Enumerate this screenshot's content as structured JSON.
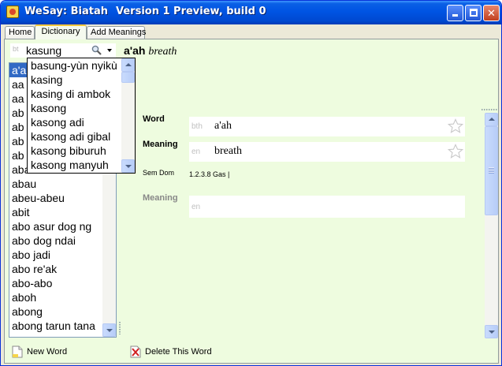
{
  "window": {
    "title": "WeSay: Biatah",
    "version": "Version 1 Preview, build 0"
  },
  "titlebar_buttons": {
    "minimize": "minimize-button",
    "maximize": "maximize-button",
    "close": "close-button"
  },
  "tabs": [
    {
      "label": "Home",
      "active": false
    },
    {
      "label": "Dictionary",
      "active": true
    },
    {
      "label": "Add Meanings",
      "active": false
    }
  ],
  "search": {
    "ws": "bt",
    "value": "kasung",
    "icon": "magnifier-icon"
  },
  "entry_header": {
    "headword": "a'ah",
    "gloss": "breath"
  },
  "word_list": {
    "items": [
      "a'ah",
      "aa",
      "aa",
      "ab",
      "ab",
      "ab",
      "ab",
      "abau tabi",
      "abau",
      "abeu-abeu",
      "abit",
      "abo asur dog ng",
      "abo dog ndai",
      "abo jadi",
      "abo re'ak",
      "abo-abo",
      "aboh",
      "abong",
      "abong tarun tana"
    ],
    "selected_index": 0
  },
  "dropdown": {
    "items": [
      "basung-yùn nyikù",
      "kasing",
      "kasing di ambok",
      "kasong",
      "kasong adi",
      "kasong adi gibal",
      "kasong biburuh",
      "kasong manyuh"
    ]
  },
  "fields": {
    "word": {
      "label": "Word",
      "ws": "bth",
      "value": "a'ah"
    },
    "meaning": {
      "label": "Meaning",
      "ws": "en",
      "value": "breath"
    },
    "semdom": {
      "label": "Sem Dom",
      "value": "1.2.3.8 Gas |"
    },
    "meaning2": {
      "label": "Meaning",
      "ws": "en",
      "value": ""
    }
  },
  "bottom": {
    "new_word": "New Word",
    "delete_word": "Delete This Word"
  },
  "colors": {
    "client_bg": "#eefcdf",
    "selection": "#316ac5",
    "titlebar": "#0054e3"
  }
}
